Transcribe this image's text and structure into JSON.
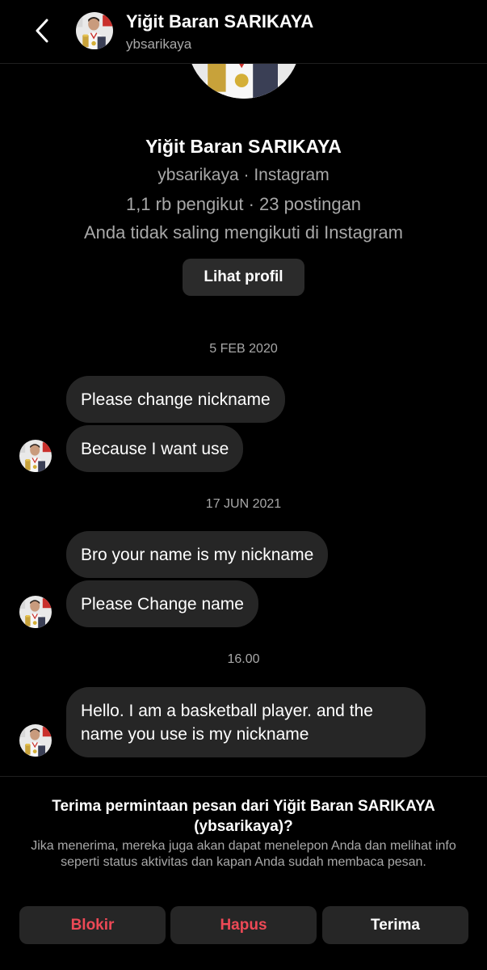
{
  "header": {
    "back_icon": "chevron-left-icon",
    "name": "Yiğit Baran SARIKAYA",
    "username": "ybsarikaya"
  },
  "profile": {
    "name": "Yiğit Baran SARIKAYA",
    "subtitle": "ybsarikaya · Instagram",
    "stats": "1,1 rb pengikut · 23 postingan",
    "follow_status": "Anda tidak saling mengikuti di Instagram",
    "view_profile_label": "Lihat profil"
  },
  "conversation": [
    {
      "date": "5 FEB 2020",
      "messages": [
        "Please change nickname",
        "Because I want use"
      ]
    },
    {
      "date": "17 JUN 2021",
      "messages": [
        "Bro your name is my nickname",
        "Please Change name"
      ]
    },
    {
      "date": "16.00",
      "messages": [
        "Hello. I am a basketball player. and the name you use is my nickname"
      ]
    }
  ],
  "request": {
    "title": "Terima permintaan pesan dari Yiğit Baran SARIKAYA (ybsarikaya)?",
    "description": "Jika menerima, mereka juga akan dapat menelepon Anda dan melihat info seperti status aktivitas dan kapan Anda sudah membaca pesan.",
    "block_label": "Blokir",
    "delete_label": "Hapus",
    "accept_label": "Terima"
  },
  "colors": {
    "background": "#000000",
    "bubble": "#262626",
    "button": "#2b2b2b",
    "danger": "#ed4956",
    "muted_text": "#a8a8a8"
  }
}
